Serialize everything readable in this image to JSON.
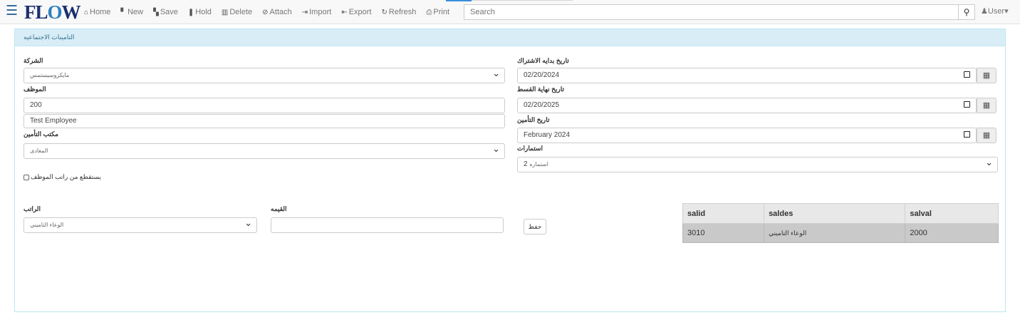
{
  "app": {
    "logo_prefix": "FL",
    "logo_o": "O",
    "logo_suffix": "W"
  },
  "navbar": {
    "items": [
      {
        "icon": "home-icon",
        "glyph": "⌂",
        "label": "Home"
      },
      {
        "icon": "new-icon",
        "glyph": "▘",
        "label": "New"
      },
      {
        "icon": "save-icon",
        "glyph": "▚",
        "label": "Save"
      },
      {
        "icon": "hold-icon",
        "glyph": "❚",
        "label": "Hold"
      },
      {
        "icon": "delete-icon",
        "glyph": "▥",
        "label": "Delete"
      },
      {
        "icon": "attach-icon",
        "glyph": "⊘",
        "label": "Attach"
      },
      {
        "icon": "import-icon",
        "glyph": "⇥",
        "label": "Import"
      },
      {
        "icon": "export-icon",
        "glyph": "⇤",
        "label": "Export"
      },
      {
        "icon": "refresh-icon",
        "glyph": "↻",
        "label": "Refresh"
      },
      {
        "icon": "print-icon",
        "glyph": "⎙",
        "label": "Print"
      }
    ],
    "search_placeholder": "Search",
    "search_glyph": "⚲",
    "user_label": "User",
    "user_glyph": "♟",
    "user_caret": "▾"
  },
  "panel": {
    "title": "التامينات الاجتماعيه"
  },
  "form": {
    "company_label": "الشركة",
    "company_value": "مايكروسيستمس",
    "employee_label": "الموظف",
    "employee_code": "200",
    "employee_name": "Test Employee",
    "office_label": "مكتب التأمين",
    "office_value": "المعادى",
    "deduct_label": "يستقطع من راتب الموظف",
    "salary_label": "الراتب",
    "salary_value": "الوعاء التاميني",
    "amount_label": "القيمه",
    "amount_value": "",
    "save_button": "حفظ",
    "sub_start_label": "تاريخ بدايه الاشتراك",
    "sub_start_value": "02/20/2024",
    "install_end_label": "تاريخ نهاية القسط",
    "install_end_value": "02/20/2025",
    "insurance_date_label": "تاريخ التأمين",
    "insurance_date_value": "February 2024",
    "forms_label": "استمارات",
    "forms_value_num": "2",
    "forms_value_text": "استماره",
    "calendar_glyph": "▦"
  },
  "grid": {
    "headers": [
      "salid",
      "saldes",
      "salval"
    ],
    "rows": [
      [
        "3010",
        "الوعاء التاميني",
        "2000"
      ]
    ]
  }
}
